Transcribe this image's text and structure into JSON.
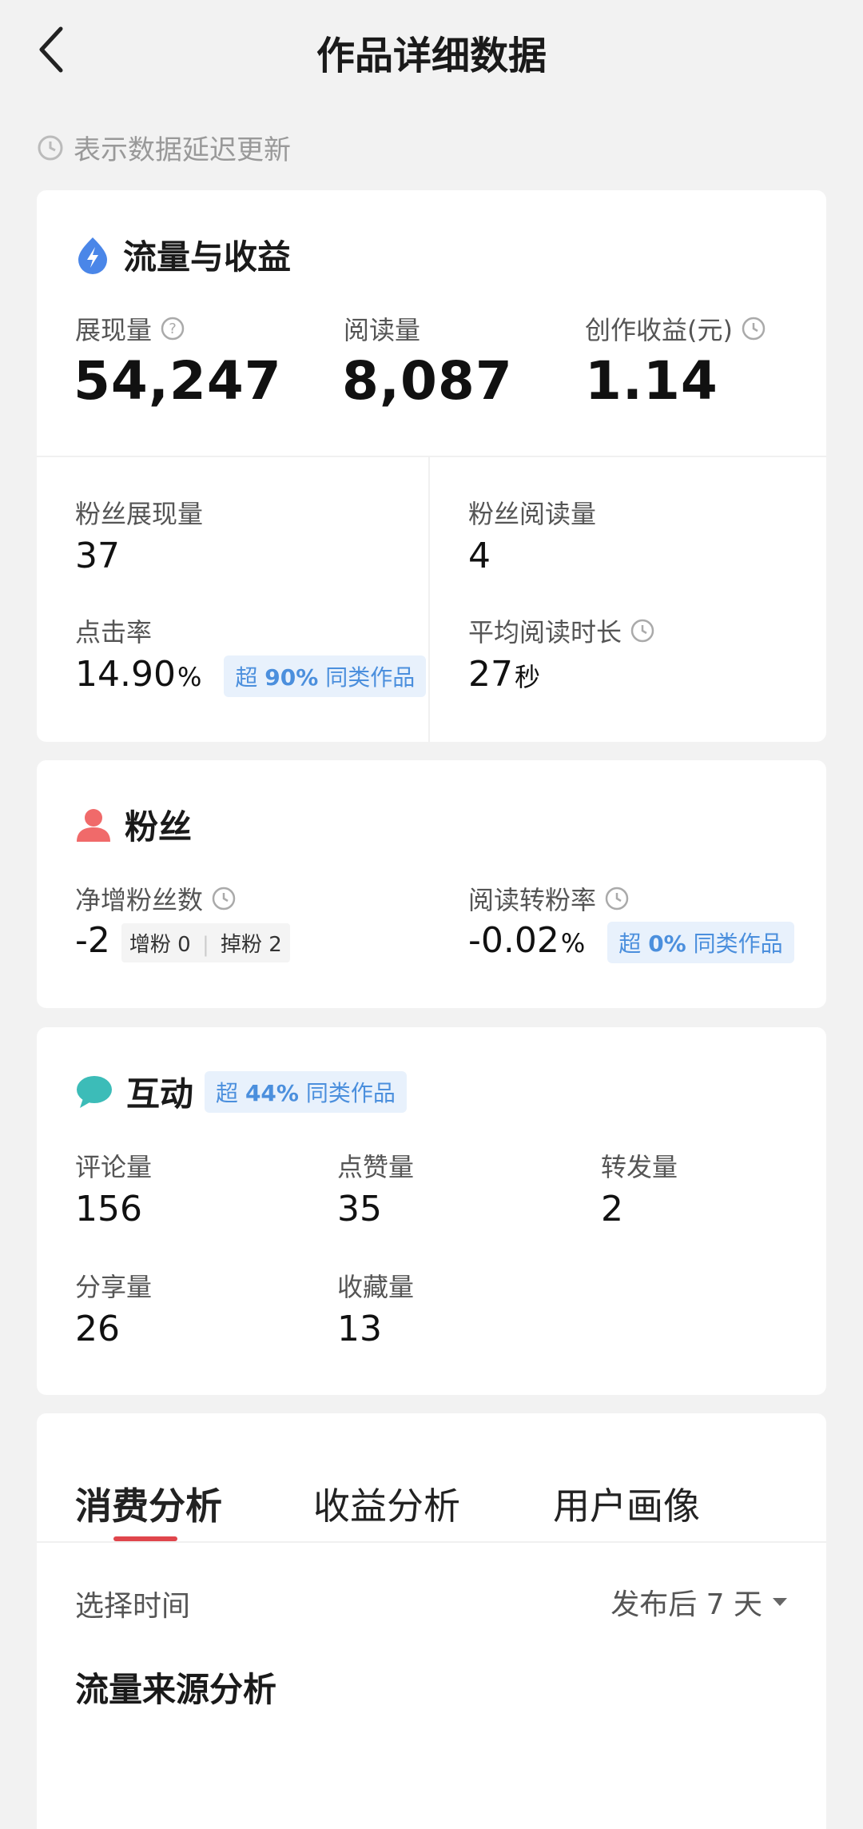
{
  "header": {
    "title": "作品详细数据"
  },
  "delay_note": "表示数据延迟更新",
  "traffic": {
    "title": "流量与收益",
    "impressions_label": "展现量",
    "impressions_value": "54,247",
    "reads_label": "阅读量",
    "reads_value": "8,087",
    "earnings_label": "创作收益(元)",
    "earnings_value": "1.14",
    "fan_impressions_label": "粉丝展现量",
    "fan_impressions_value": "37",
    "fan_reads_label": "粉丝阅读量",
    "fan_reads_value": "4",
    "ctr_label": "点击率",
    "ctr_value": "14.90",
    "ctr_unit": "%",
    "ctr_badge_prefix": "超",
    "ctr_badge_pct": "90%",
    "ctr_badge_suffix": "同类作品",
    "avg_read_label": "平均阅读时长",
    "avg_read_value": "27",
    "avg_read_unit": "秒"
  },
  "fans": {
    "title": "粉丝",
    "net_label": "净增粉丝数",
    "net_value": "-2",
    "gain_label": "增粉",
    "gain_value": "0",
    "loss_label": "掉粉",
    "loss_value": "2",
    "conv_label": "阅读转粉率",
    "conv_value": "-0.02",
    "conv_unit": "%",
    "conv_badge_prefix": "超",
    "conv_badge_pct": "0%",
    "conv_badge_suffix": "同类作品"
  },
  "interaction": {
    "title": "互动",
    "badge_prefix": "超",
    "badge_pct": "44%",
    "badge_suffix": "同类作品",
    "comments_label": "评论量",
    "comments_value": "156",
    "likes_label": "点赞量",
    "likes_value": "35",
    "forwards_label": "转发量",
    "forwards_value": "2",
    "shares_label": "分享量",
    "shares_value": "26",
    "favorites_label": "收藏量",
    "favorites_value": "13"
  },
  "analysis": {
    "tabs": [
      "消费分析",
      "收益分析",
      "用户画像"
    ],
    "select_time_label": "选择时间",
    "select_time_value": "发布后 7 天",
    "section_title": "流量来源分析"
  },
  "colors": {
    "accent_red": "#e0464c",
    "badge_blue": "#4b8fdd",
    "badge_bg": "#e8f1fc"
  }
}
